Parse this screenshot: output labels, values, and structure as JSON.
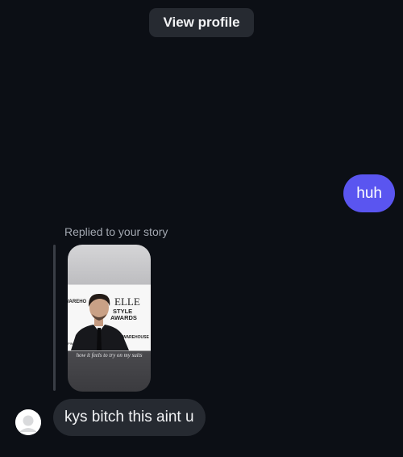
{
  "header": {
    "view_profile_label": "View profile"
  },
  "messages": {
    "outgoing_1": "huh",
    "story_reply_caption": "Replied to your story",
    "story_overlay_text": "how it feels to try on my suits",
    "story_photo_backdrop_text": [
      "ELLE",
      "STYLE",
      "AWARDS",
      "WAREHOUSE"
    ],
    "incoming_1": "kys bitch this aint u"
  },
  "colors": {
    "background": "#0c0f15",
    "outgoing_bubble": "#5a55f0",
    "incoming_bubble": "#262a31",
    "caption_text": "#a3a8b1"
  },
  "icons": {
    "avatar": "default-avatar-icon"
  }
}
